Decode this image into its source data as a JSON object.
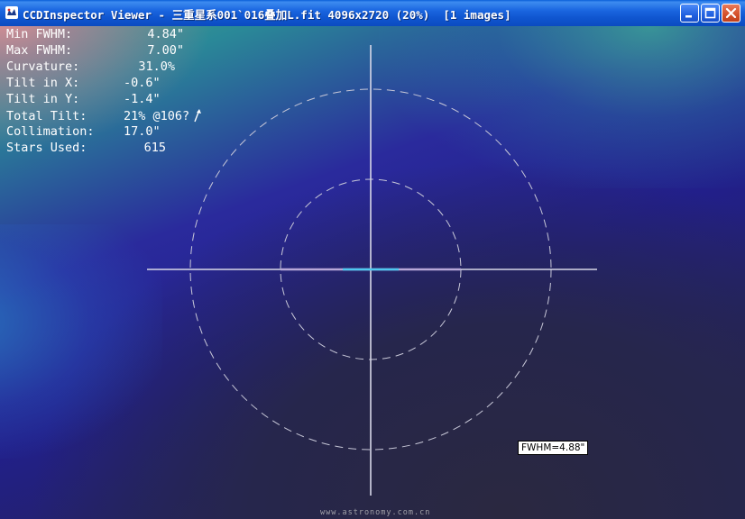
{
  "window": {
    "title": "CCDInspector Viewer - 三重星系001`016叠加L.fit 4096x2720 (20%)  [1 images]"
  },
  "stats": [
    {
      "label": "Min FWHM:",
      "value": "4.84\""
    },
    {
      "label": "Max FWHM:",
      "value": "7.00\""
    },
    {
      "label": "Curvature:",
      "value": "31.0%"
    },
    {
      "label": "Tilt in X:",
      "value": "-0.6\""
    },
    {
      "label": "Tilt in Y:",
      "value": "-1.4\""
    },
    {
      "label": "Total Tilt:",
      "value": "21% @106?"
    },
    {
      "label": "Collimation:",
      "value": "17.0\""
    },
    {
      "label": "Stars Used:",
      "value": "615"
    }
  ],
  "tooltip": {
    "fwhm": "FWHM=4.88\""
  },
  "watermark": "www.astronomy.com.cn",
  "colors": {
    "crosshair": "#d8d8e8",
    "circles": "#c8c8d8",
    "tilt_segment": "#4ec8f0",
    "titlebar": "#0f55cf"
  },
  "icons": {
    "app": "ccd-app-icon",
    "minimize": "minimize-icon",
    "maximize": "maximize-icon",
    "close": "close-icon",
    "tilt_direction": "tilt-arrow-icon"
  }
}
